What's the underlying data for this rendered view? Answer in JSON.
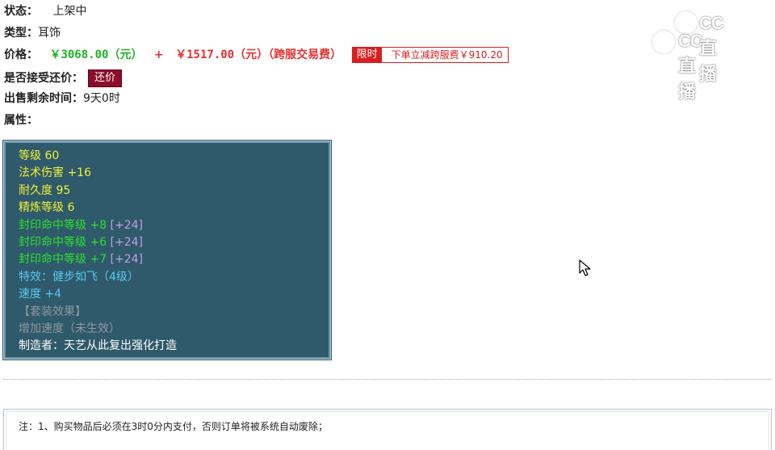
{
  "status": {
    "label": "状态：",
    "value": "上架中"
  },
  "type": {
    "label": "类型：",
    "value": "耳饰"
  },
  "price": {
    "label": "价格：",
    "base": "￥3068.00（元）",
    "plus": "+",
    "fee_amount": "￥1517.00（元）",
    "fee_note": "（跨服交易费）",
    "promo_tag": "限时",
    "promo_text": "下单立减跨服费￥910.20"
  },
  "counter_offer": {
    "label": "是否接受还价：",
    "button": "还价"
  },
  "time_left": {
    "label": "出售剩余时间：",
    "value": "9天0时"
  },
  "attributes_label": "属性：",
  "attributes": {
    "level": "等级 60",
    "spell_damage": "法术伤害 +16",
    "durability": "耐久度 95",
    "refine": "精炼等级 6",
    "seal1": "封印命中等级 +8",
    "seal1_bonus": "[+24]",
    "seal2": "封印命中等级 +6",
    "seal2_bonus": "[+24]",
    "seal3": "封印命中等级 +7",
    "seal3_bonus": "[+24]",
    "special": "特效：健步如飞（4级）",
    "speed": "速度 +4",
    "set_effect": "【套装效果】",
    "set_bonus": "增加速度（未生效）",
    "maker": "制造者：天艺从此复出强化打造"
  },
  "note": "注：1、购买物品后必须在3时0分内支付，否则订单将被系统自动废除；",
  "watermark": {
    "top": "CC直播",
    "bottom": "CC直播"
  },
  "colors": {
    "box_bg": "#2e5a6b",
    "price_green": "#1fb324",
    "price_red": "#e23030",
    "button_bg": "#8b0d2a"
  }
}
